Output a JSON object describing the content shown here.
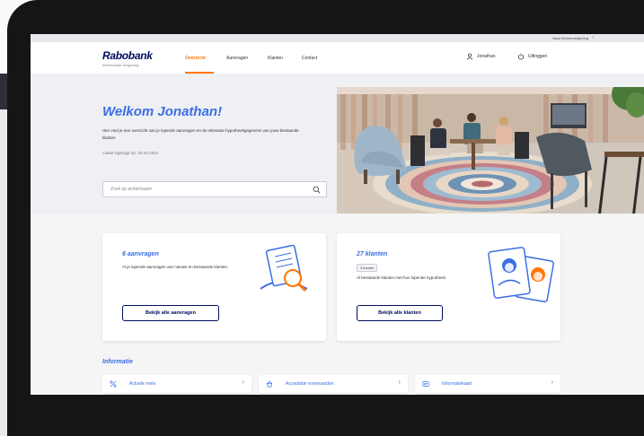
{
  "topbar": {
    "utility_link": "Naar beheeromgeving",
    "utility_arrow": "›"
  },
  "nav": {
    "logo": "Rabobank",
    "logo_sub": "Intermediair Omgeving",
    "links": [
      "Overzicht",
      "Aanvragen",
      "Klanten",
      "Contact"
    ],
    "active_link": "Overzicht",
    "user": "Jonathan",
    "logout": "Uitloggen"
  },
  "hero": {
    "title": "Welkom Jonathan!",
    "intro": "Hier vind je een overzicht van je lopende aanvragen en de relevante hypotheekgegevens van jouw bestaande klanten",
    "last_login": "Laatst ingelogd op: 25-04-2021",
    "search_placeholder": "Zoek op achternaam"
  },
  "cards": {
    "aanvragen": {
      "title": "6 aanvragen",
      "text": "Al je lopende aanvragen van nieuwe en bestaande klanten.",
      "button": "Bekijk alle aanvragen"
    },
    "klanten": {
      "title": "27 klanten",
      "badge": "3 komen",
      "text": "Al bestaande klanten met hun lopende hypotheek.",
      "button": "Bekijk alle klanten"
    }
  },
  "info": {
    "title": "Informatie",
    "tiles": [
      {
        "label": "Actuele rente",
        "icon": "percent-icon"
      },
      {
        "label": "Acceptatie voorwaarden",
        "icon": "house-icon"
      },
      {
        "label": "Informatiekaart",
        "icon": "card-icon"
      }
    ],
    "chevron": "›"
  },
  "colors": {
    "brand_navy": "#000d5e",
    "accent_orange": "#ff7700",
    "link_blue": "#3b6ee4"
  }
}
